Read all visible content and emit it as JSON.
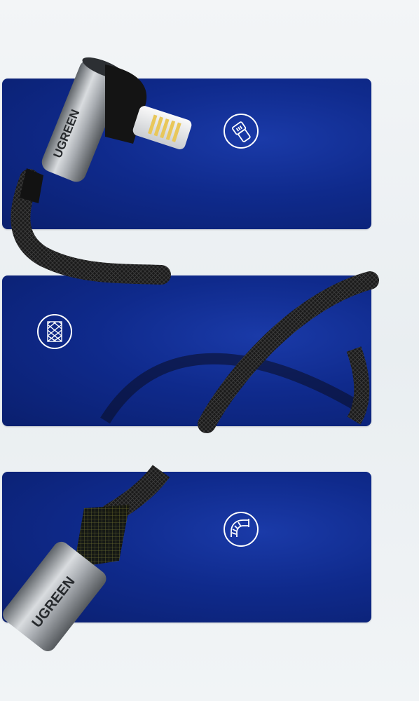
{
  "brand_text": "UGREEN",
  "colors": {
    "panel": "#0f2a8c",
    "background": "#eef2f4",
    "cable": "#1b1b1b",
    "metal": "#b8bcc0"
  },
  "panels": [
    {
      "name": "connector-panel",
      "icon": "lightning-connector-icon"
    },
    {
      "name": "braided-cable-panel",
      "icon": "braided-mesh-icon"
    },
    {
      "name": "bend-durability-panel",
      "icon": "bend-resistant-icon"
    }
  ]
}
